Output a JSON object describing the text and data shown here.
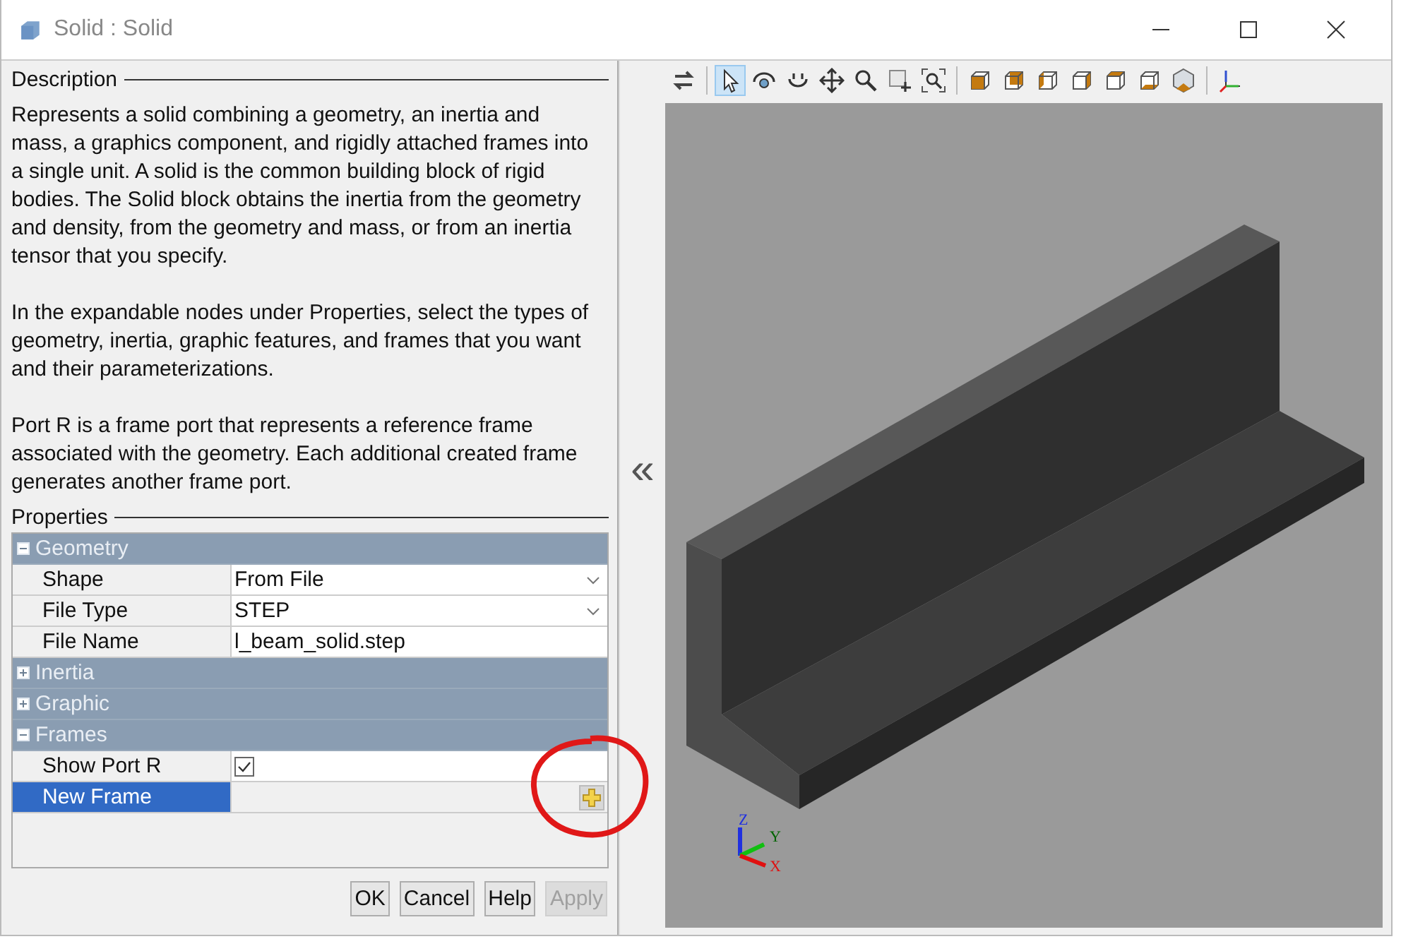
{
  "window": {
    "title": "Solid : Solid"
  },
  "description": {
    "heading": "Description",
    "paragraphs": [
      "Represents a solid combining a geometry, an inertia and mass, a graphics component, and rigidly attached frames into a single unit. A solid is the common building block of rigid bodies. The Solid block obtains the inertia from the geometry and density, from the geometry and mass, or from an inertia tensor that you specify.",
      "In the expandable nodes under Properties, select the types of geometry, inertia, graphic features, and frames that you want and their parameterizations.",
      "Port R is a frame port that represents a reference frame associated with the geometry. Each additional created frame generates another frame port."
    ]
  },
  "properties": {
    "heading": "Properties",
    "groups": [
      {
        "label": "Geometry",
        "expanded": true,
        "rows": [
          {
            "label": "Shape",
            "kind": "dropdown",
            "value": "From File",
            "selected": false
          },
          {
            "label": "File Type",
            "kind": "dropdown",
            "value": "STEP",
            "selected": false
          },
          {
            "label": "File Name",
            "kind": "text",
            "value": "l_beam_solid.step",
            "selected": false
          }
        ]
      },
      {
        "label": "Inertia",
        "expanded": false
      },
      {
        "label": "Graphic",
        "expanded": false
      },
      {
        "label": "Frames",
        "expanded": true,
        "rows": [
          {
            "label": "Show Port R",
            "kind": "checkbox",
            "checked": true,
            "selected": false
          },
          {
            "label": "New Frame",
            "kind": "action",
            "selected": true
          }
        ]
      }
    ]
  },
  "buttons": [
    {
      "label": "OK",
      "disabled": false
    },
    {
      "label": "Cancel",
      "disabled": false
    },
    {
      "label": "Help",
      "disabled": false
    },
    {
      "label": "Apply",
      "disabled": true
    }
  ],
  "splitter": {
    "glyph": "«"
  },
  "toolbar": [
    {
      "tools": [
        {
          "kind": "swap",
          "selected": false
        }
      ]
    },
    {
      "tools": [
        {
          "kind": "pointer",
          "selected": true
        },
        {
          "kind": "rotate",
          "selected": false
        },
        {
          "kind": "spin",
          "selected": false
        },
        {
          "kind": "pan",
          "selected": false
        },
        {
          "kind": "zoom",
          "selected": false
        },
        {
          "kind": "zoom-box",
          "selected": false
        },
        {
          "kind": "zoom-fit",
          "selected": false
        }
      ]
    },
    {
      "tools": [
        {
          "kind": "view-front",
          "selected": false
        },
        {
          "kind": "view-back",
          "selected": false
        },
        {
          "kind": "view-left",
          "selected": false
        },
        {
          "kind": "view-right",
          "selected": false
        },
        {
          "kind": "view-top",
          "selected": false
        },
        {
          "kind": "view-bottom",
          "selected": false
        },
        {
          "kind": "view-iso",
          "selected": false
        }
      ]
    },
    {
      "tools": [
        {
          "kind": "axes",
          "selected": false
        }
      ]
    }
  ],
  "viewer": {
    "axes": [
      "Z",
      "Y",
      "X"
    ]
  }
}
